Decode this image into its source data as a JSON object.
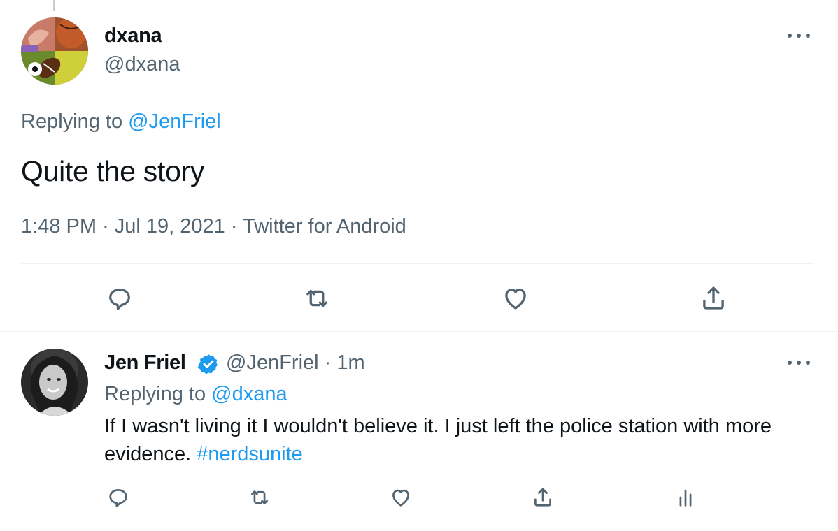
{
  "main_tweet": {
    "author_name": "dxana",
    "author_handle": "@dxana",
    "replying_prefix": "Replying to",
    "replying_to": "@JenFriel",
    "text": "Quite the story",
    "time": "1:48 PM",
    "separator": "·",
    "date": "Jul 19, 2021",
    "source": "Twitter for Android",
    "actions": [
      "reply-icon",
      "retweet-icon",
      "like-icon",
      "share-icon"
    ]
  },
  "reply_tweet": {
    "author_name": "Jen Friel",
    "verified": true,
    "author_handle": "@JenFriel",
    "separator": "·",
    "age": "1m",
    "replying_prefix": "Replying to",
    "replying_to": "@dxana",
    "text": "If I wasn't living it I wouldn't believe it. I just left the police station with more evidence.",
    "hashtag": "#nerdsunite",
    "actions": [
      "reply-icon",
      "retweet-icon",
      "like-icon",
      "share-icon",
      "analytics-icon"
    ]
  },
  "colors": {
    "link": "#1d9bf0",
    "secondary_text": "#536471",
    "primary_text": "#0f1419",
    "divider": "#eff3f4"
  }
}
